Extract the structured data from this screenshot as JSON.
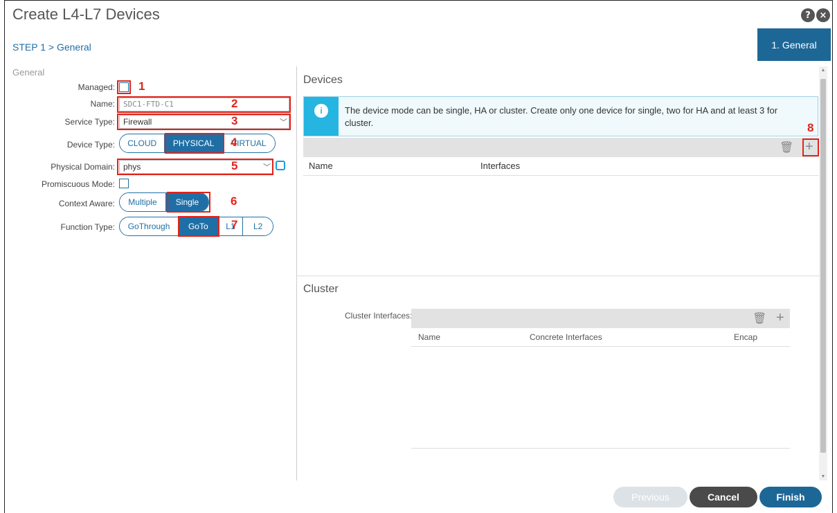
{
  "window": {
    "title": "Create L4-L7 Devices",
    "help_icon": "?",
    "close_icon": "×"
  },
  "step": {
    "breadcrumb": "STEP 1 > General",
    "tab_label": "1. General"
  },
  "general": {
    "section_label": "General",
    "managed_label": "Managed:",
    "name_label": "Name:",
    "name_value": "SDC1-FTD-C1",
    "service_type_label": "Service Type:",
    "service_type_value": "Firewall",
    "device_type_label": "Device Type:",
    "device_type_options": [
      "CLOUD",
      "PHYSICAL",
      "VIRTUAL"
    ],
    "device_type_selected": "PHYSICAL",
    "physical_domain_label": "Physical Domain:",
    "physical_domain_value": "phys",
    "promiscuous_label": "Promiscuous Mode:",
    "context_aware_label": "Context Aware:",
    "context_aware_options": [
      "Multiple",
      "Single"
    ],
    "context_aware_selected": "Single",
    "function_type_label": "Function Type:",
    "function_type_options": [
      "GoThrough",
      "GoTo",
      "L1",
      "L2"
    ],
    "function_type_selected": "GoTo"
  },
  "annotations": [
    "1",
    "2",
    "3",
    "4",
    "5",
    "6",
    "7",
    "8"
  ],
  "devices": {
    "title": "Devices",
    "info_icon": "i",
    "info_text": "The device mode can be single, HA or cluster. Create only one device for single, two for HA and at least 3 for cluster.",
    "columns": [
      "Name",
      "Interfaces"
    ]
  },
  "cluster": {
    "title": "Cluster",
    "interfaces_label": "Cluster Interfaces:",
    "columns": [
      "Name",
      "Concrete Interfaces",
      "Encap"
    ]
  },
  "footer": {
    "previous": "Previous",
    "cancel": "Cancel",
    "finish": "Finish"
  },
  "colors": {
    "accent": "#1d6797",
    "annotation": "#e0241b",
    "info": "#25b5e0"
  }
}
